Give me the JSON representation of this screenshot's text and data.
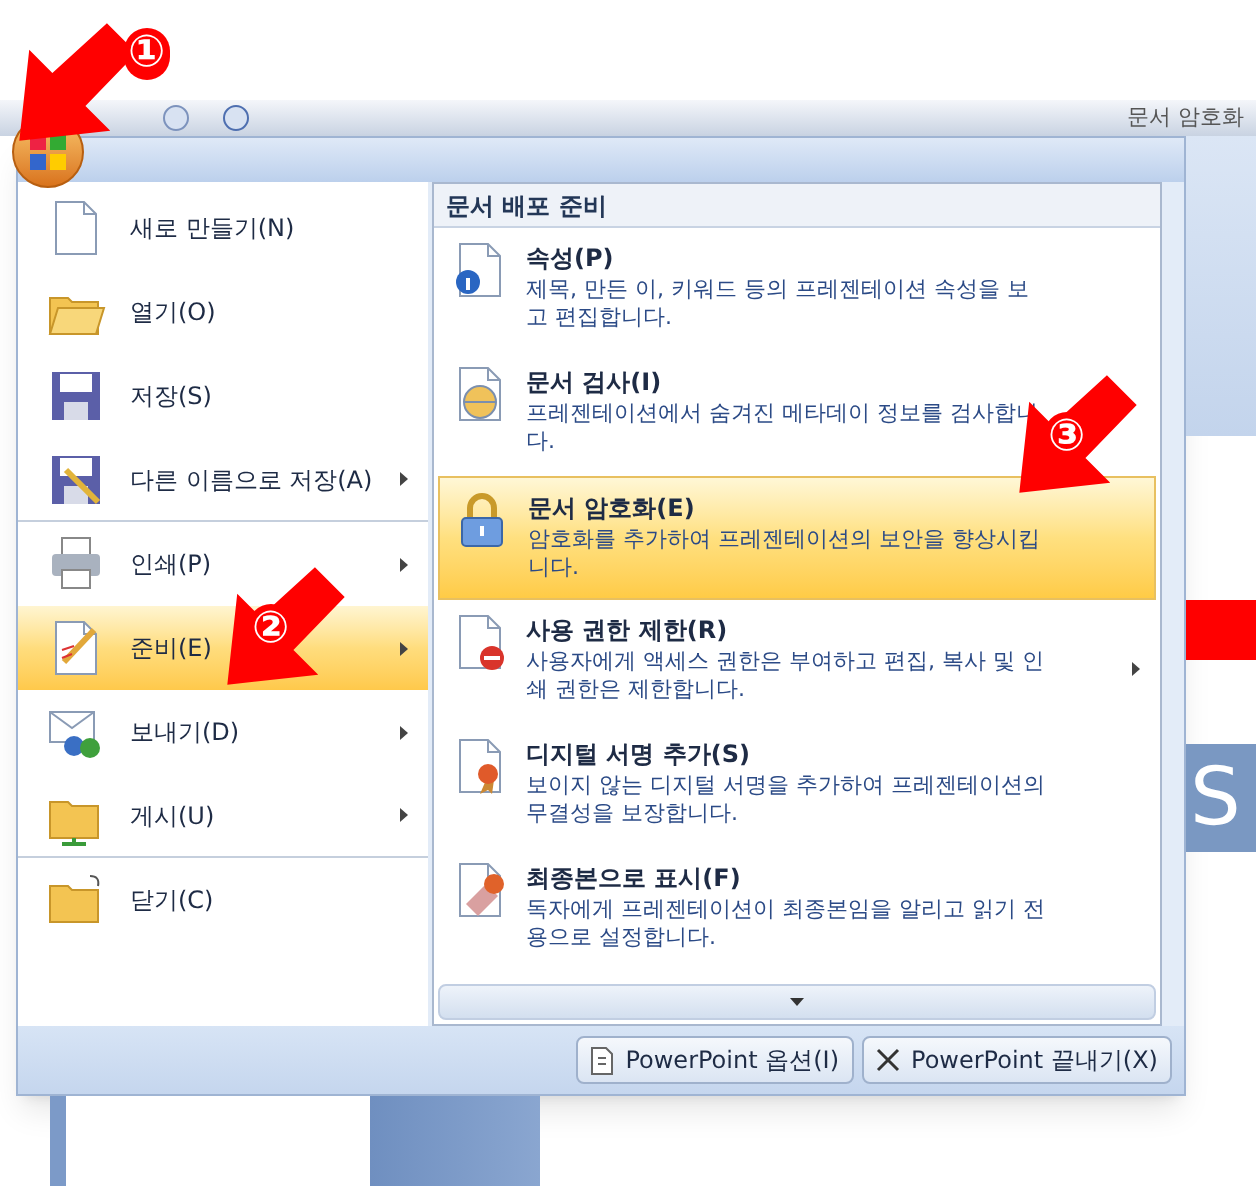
{
  "window": {
    "title": "문서 암호화"
  },
  "office_menu": {
    "left_items": [
      {
        "label": "새로 만들기(N)",
        "submenu": false,
        "selected": false,
        "separator_after": false
      },
      {
        "label": "열기(O)",
        "submenu": false,
        "selected": false,
        "separator_after": false
      },
      {
        "label": "저장(S)",
        "submenu": false,
        "selected": false,
        "separator_after": false
      },
      {
        "label": "다른 이름으로 저장(A)",
        "submenu": true,
        "selected": false,
        "separator_after": true
      },
      {
        "label": "인쇄(P)",
        "submenu": true,
        "selected": false,
        "separator_after": false
      },
      {
        "label": "준비(E)",
        "submenu": true,
        "selected": true,
        "separator_after": false
      },
      {
        "label": "보내기(D)",
        "submenu": true,
        "selected": false,
        "separator_after": false
      },
      {
        "label": "게시(U)",
        "submenu": true,
        "selected": false,
        "separator_after": true
      },
      {
        "label": "닫기(C)",
        "submenu": false,
        "selected": false,
        "separator_after": false
      }
    ],
    "submenu": {
      "title": "문서 배포 준비",
      "items": [
        {
          "title": "속성(P)",
          "description": "제목, 만든 이, 키워드 등의 프레젠테이션 속성을 보고 편집합니다.",
          "selected": false,
          "submenu": false
        },
        {
          "title": "문서 검사(I)",
          "description": "프레젠테이션에서 숨겨진 메타데이 정보를 검사합니다.",
          "selected": false,
          "submenu": false
        },
        {
          "title": "문서 암호화(E)",
          "description": "암호화를 추가하여 프레젠테이션의 보안을 향상시킵니다.",
          "selected": true,
          "submenu": false
        },
        {
          "title": "사용 권한 제한(R)",
          "description": "사용자에게 액세스 권한은 부여하고 편집, 복사 및 인쇄 권한은 제한합니다.",
          "selected": false,
          "submenu": true
        },
        {
          "title": "디지털 서명 추가(S)",
          "description": "보이지 않는 디지털 서명을 추가하여 프레젠테이션의 무결성을 보장합니다.",
          "selected": false,
          "submenu": false
        },
        {
          "title": "최종본으로 표시(F)",
          "description": "독자에게 프레젠테이션이 최종본임을 알리고 읽기 전용으로 설정합니다.",
          "selected": false,
          "submenu": false
        }
      ]
    },
    "buttons": [
      {
        "label": "PowerPoint 옵션(I)",
        "kind": "options"
      },
      {
        "label": "PowerPoint 끝내기(X)",
        "kind": "exit"
      }
    ]
  },
  "slide": {
    "text": "S"
  },
  "annotations": [
    {
      "label": "①"
    },
    {
      "label": "②"
    },
    {
      "label": "③"
    }
  ]
}
